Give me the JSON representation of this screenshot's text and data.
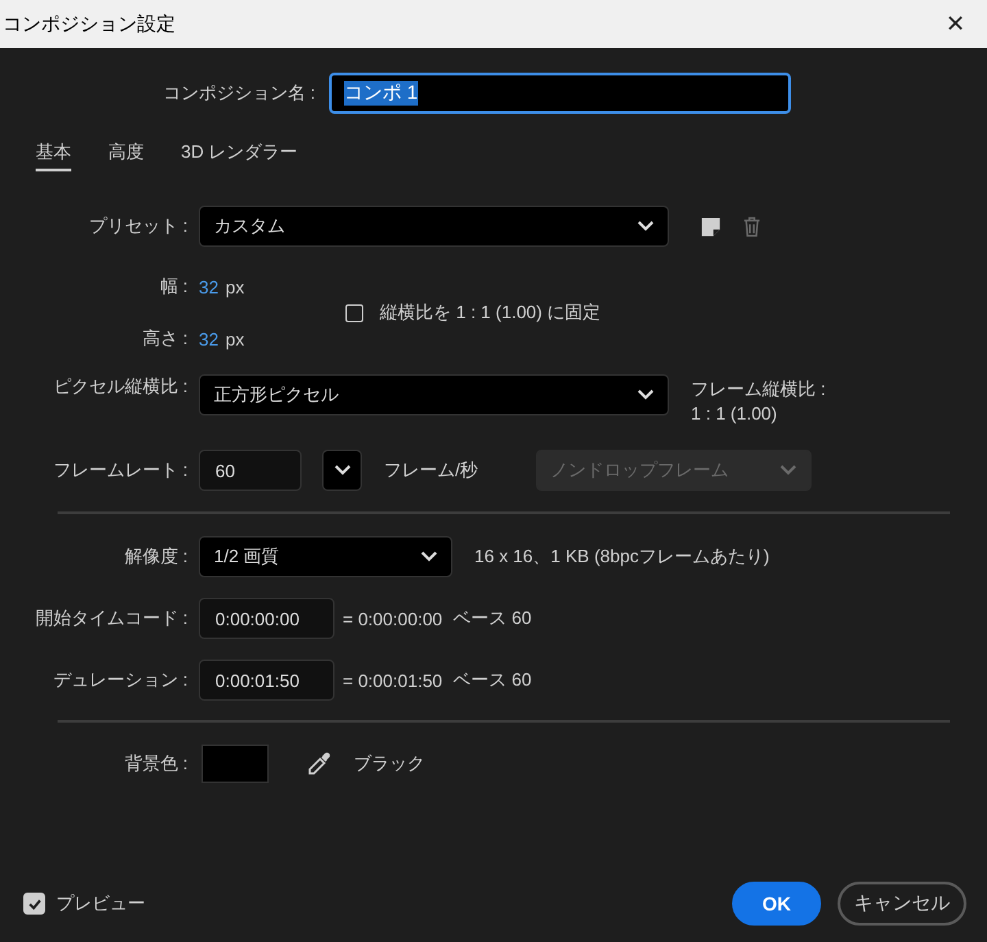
{
  "window": {
    "title": "コンポジション設定",
    "close": "✕"
  },
  "comp_name": {
    "label": "コンポジション名 :",
    "value": "コンポ 1",
    "text_selected": true
  },
  "tabs": [
    {
      "label": "基本",
      "selected": true
    },
    {
      "label": "高度",
      "selected": false
    },
    {
      "label": "3D レンダラー",
      "selected": false
    }
  ],
  "preset": {
    "label": "プリセット :",
    "value": "カスタム"
  },
  "width": {
    "label": "幅 :",
    "value": "32",
    "unit": "px"
  },
  "height": {
    "label": "高さ :",
    "value": "32",
    "unit": "px"
  },
  "lock_aspect": {
    "label": "縦横比を 1 : 1 (1.00) に固定",
    "checked": false
  },
  "pixel_aspect": {
    "label": "ピクセル縦横比 :",
    "value": "正方形ピクセル"
  },
  "frame_aspect": {
    "label": "フレーム縦横比 :",
    "value": "1 : 1 (1.00)"
  },
  "frame_rate": {
    "label": "フレームレート :",
    "value": "60",
    "unit": "フレーム/秒",
    "drop_frame": {
      "value": "ノンドロップフレーム",
      "disabled": true
    }
  },
  "resolution": {
    "label": "解像度 :",
    "value": "1/2 画質",
    "info": "16 x 16、1 KB (8bpcフレームあたり)"
  },
  "start_timecode": {
    "label": "開始タイムコード :",
    "value": "0:00:00:00",
    "equals": "= 0:00:00:00",
    "base": "ベース 60"
  },
  "duration": {
    "label": "デュレーション :",
    "value": "0:00:01:50",
    "equals": "= 0:00:01:50",
    "base": "ベース 60"
  },
  "background": {
    "label": "背景色 :",
    "color": "#000000",
    "name": "ブラック"
  },
  "preview": {
    "label": "プレビュー",
    "checked": true
  },
  "buttons": [
    {
      "label": "OK",
      "kind": "primary"
    },
    {
      "label": "キャンセル",
      "kind": "secondary"
    }
  ]
}
